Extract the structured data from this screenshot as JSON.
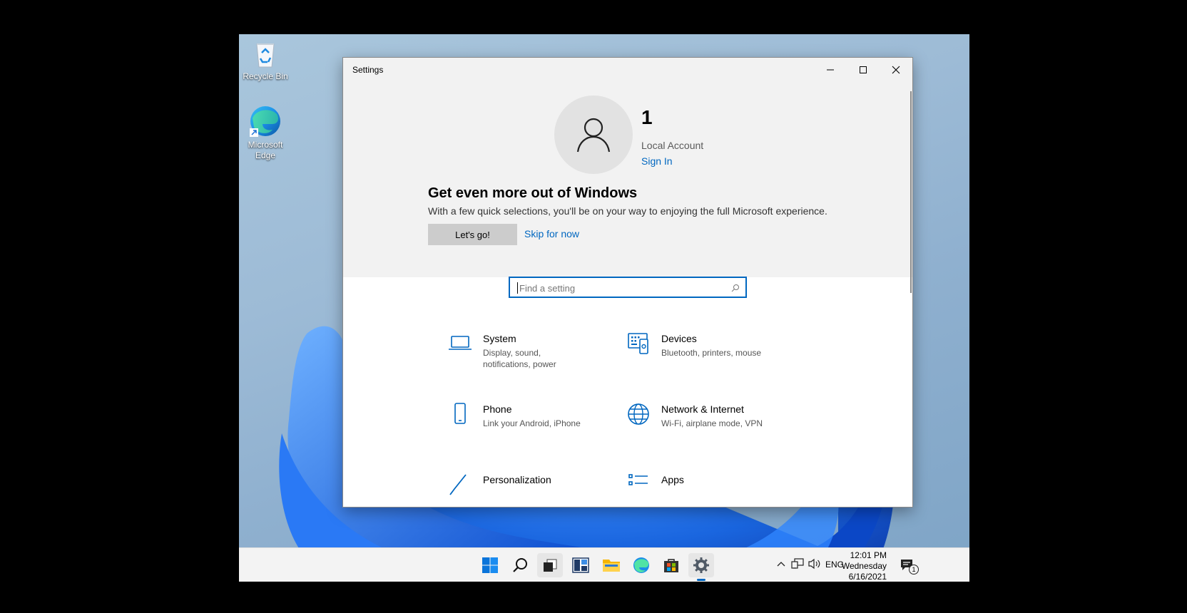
{
  "desktop": {
    "icons": [
      {
        "label": "Recycle Bin"
      },
      {
        "label": "Microsoft Edge"
      }
    ]
  },
  "window": {
    "title": "Settings",
    "controls": {
      "minimize": "minimize-icon",
      "maximize": "maximize-icon",
      "close": "close-icon"
    }
  },
  "account": {
    "name": "1",
    "type": "Local Account",
    "sign_in": "Sign In"
  },
  "promo": {
    "title": "Get even more out of Windows",
    "text": "With a few quick selections, you'll be on your way to enjoying the full Microsoft experience.",
    "primary_button": "Let's go!",
    "secondary_link": "Skip for now"
  },
  "search": {
    "placeholder": "Find a setting",
    "value": ""
  },
  "categories": [
    {
      "name": "System",
      "description": "Display, sound, notifications, power",
      "icon": "laptop-icon"
    },
    {
      "name": "Devices",
      "description": "Bluetooth, printers, mouse",
      "icon": "keyboard-devices-icon"
    },
    {
      "name": "Phone",
      "description": "Link your Android, iPhone",
      "icon": "phone-icon"
    },
    {
      "name": "Network & Internet",
      "description": "Wi-Fi, airplane mode, VPN",
      "icon": "globe-icon"
    },
    {
      "name": "Personalization",
      "description": "",
      "icon": "pen-icon"
    },
    {
      "name": "Apps",
      "description": "",
      "icon": "apps-list-icon"
    }
  ],
  "taskbar": {
    "apps": [
      "start-icon",
      "search-icon",
      "task-view-icon",
      "widgets-icon",
      "file-explorer-icon",
      "edge-icon",
      "store-icon",
      "settings-icon"
    ],
    "tray": {
      "language": "ENG",
      "time": "12:01 PM",
      "day": "Wednesday",
      "date": "6/16/2021",
      "notification_count": "1"
    }
  },
  "colors": {
    "accent": "#0067c0",
    "hero_bg": "#f2f2f2",
    "button_bg": "#cccccc",
    "wallpaper_blue": "#1a5fd6"
  }
}
